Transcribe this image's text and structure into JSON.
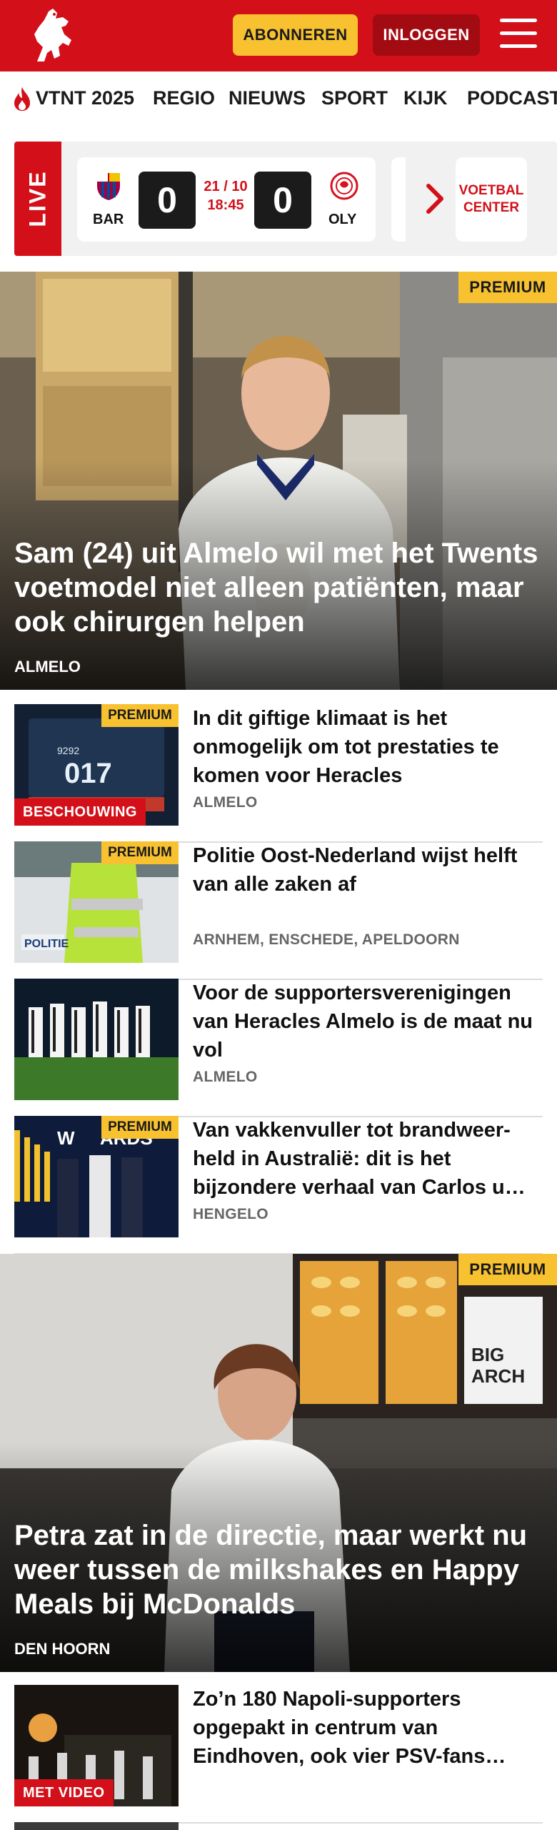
{
  "header": {
    "subscribe_label": "ABONNEREN",
    "login_label": "INLOGGEN",
    "brand_color": "#d3101a",
    "accent_color": "#f7c12f"
  },
  "nav": {
    "items": [
      "VTNT 2025",
      "REGIO",
      "NIEUWS",
      "SPORT",
      "KIJK",
      "PODCAST"
    ]
  },
  "live": {
    "label": "LIVE",
    "match": {
      "home": "BAR",
      "away": "OLY",
      "home_score": "0",
      "away_score": "0",
      "date": "21 / 10",
      "time": "18:45"
    },
    "voetbal_center": "VOETBAL CENTER"
  },
  "hero1": {
    "badge": "PREMIUM",
    "title": "Sam (24) uit Almelo wil met het Twents voetmodel niet alleen patiënten, maar ook chirurgen helpen",
    "location": "ALMELO"
  },
  "articles": [
    {
      "badge": "PREMIUM",
      "label": "BESCHOUWING",
      "title": "In dit giftige klimaat is het onmogelijk om tot prestaties te komen voor Heracles",
      "location": "ALMELO"
    },
    {
      "badge": "PREMIUM",
      "label": "",
      "title": "Politie Oost-Nederland wijst helft van alle zaken af",
      "location": "ARNHEM, ENSCHEDE, APELDOORN"
    },
    {
      "badge": "",
      "label": "",
      "title": "Voor de supportersverenigingen van Heracles Almelo is de maat nu vol",
      "location": "ALMELO"
    },
    {
      "badge": "PREMIUM",
      "label": "",
      "title": "Van vakkenvuller tot brandweer­held in Australië: dit is het bijzondere verhaal van Carlos u…",
      "location": "HENGELO"
    }
  ],
  "hero2": {
    "badge": "PREMIUM",
    "title": "Petra zat in de directie, maar werkt nu weer tussen de milkshakes en Happy Meals bij McDonalds",
    "location": "DEN HOORN"
  },
  "articles2": [
    {
      "badge": "",
      "label": "MET VIDEO",
      "title": "Zo’n 180 Napoli-supporters opgepakt in centrum van Eindhoven, ook vier PSV-fans…",
      "location": ""
    }
  ]
}
